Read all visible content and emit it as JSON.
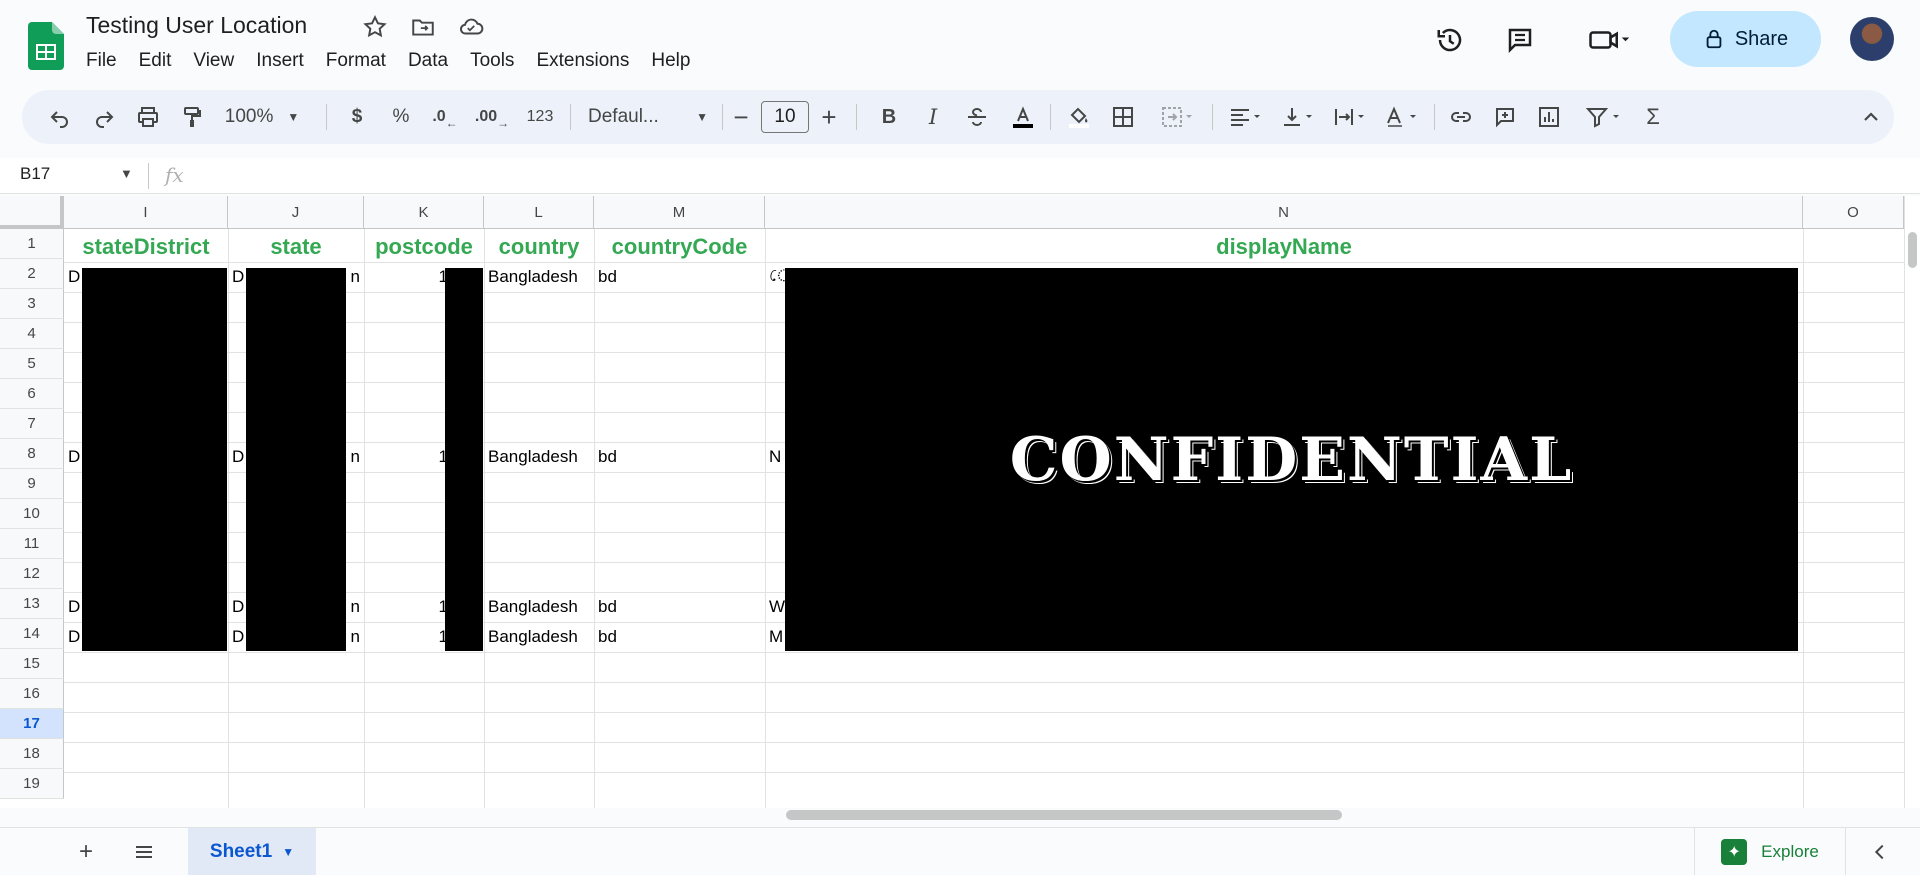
{
  "app": {
    "title": "Testing User Location",
    "menus": [
      "File",
      "Edit",
      "View",
      "Insert",
      "Format",
      "Data",
      "Tools",
      "Extensions",
      "Help"
    ],
    "share_label": "Share"
  },
  "toolbar": {
    "zoom": "100%",
    "currency": "$",
    "percent": "%",
    "decrease_decimals": ".0",
    "increase_decimals": ".00",
    "number_format": "123",
    "font": "Defaul...",
    "font_size": "10",
    "minus": "−",
    "plus": "+",
    "bold": "B",
    "italic": "I",
    "sigma": "Σ"
  },
  "formula_bar": {
    "name_box": "B17",
    "fx": "fx"
  },
  "grid": {
    "columns": [
      "I",
      "J",
      "K",
      "L",
      "M",
      "N",
      "O"
    ],
    "rows": [
      "1",
      "2",
      "3",
      "4",
      "5",
      "6",
      "7",
      "8",
      "9",
      "10",
      "11",
      "12",
      "13",
      "14",
      "15",
      "16",
      "17",
      "18",
      "19"
    ],
    "selected_row": "17",
    "headers": {
      "I": "stateDistrict",
      "J": "state",
      "K": "postcode",
      "L": "country",
      "M": "countryCode",
      "N": "displayName"
    },
    "data_rows": [
      {
        "row": "2",
        "I": "D",
        "J": "D",
        "J_end": "n",
        "K": "1",
        "L": "Bangladesh",
        "M": "bd",
        "N": "ে"
      },
      {
        "row": "8",
        "I": "D",
        "J": "D",
        "J_end": "n",
        "K": "1",
        "L": "Bangladesh",
        "M": "bd",
        "N": "N"
      },
      {
        "row": "13",
        "I": "D",
        "J": "D",
        "J_end": "n",
        "K": "1",
        "L": "Bangladesh",
        "M": "bd",
        "N": "W"
      },
      {
        "row": "14",
        "I": "D",
        "J": "D",
        "J_end": "n",
        "K": "1",
        "L": "Bangladesh",
        "M": "bd",
        "N": "M"
      }
    ],
    "overlay_text": "CONFIDENTIAL"
  },
  "sheets": {
    "tabs": [
      "Sheet1"
    ],
    "active": "Sheet1",
    "explore_label": "Explore"
  }
}
